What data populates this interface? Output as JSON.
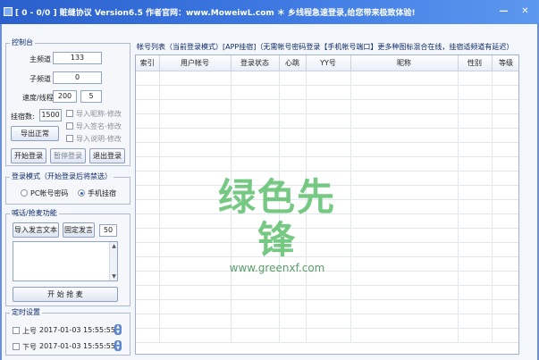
{
  "window": {
    "title": "[ 0 - 0/0 ]   赃缝协议 Version6.5   作者官网：www.MoweiwL.com   ＊  乡线程急速登录,给您带来极致体验!",
    "minimize": "—",
    "close": "✕"
  },
  "control": {
    "legend": "控制台",
    "main_channel_label": "主频道",
    "main_channel_value": "133",
    "sub_channel_label": "子频道",
    "sub_channel_value": "0",
    "speed_label": "速度/线程",
    "speed_value": "200",
    "thread_value": "5",
    "hosting_label": "挂宿数:",
    "hosting_value": "1500",
    "export_button": "导出正常",
    "import_nickname": "导入昵称-修改",
    "import_signature": "导入签名-修改",
    "import_description": "导入说明-修改",
    "start_login": "开始登录",
    "pause_login": "暂停登录",
    "exit_login": "退出登录"
  },
  "login_mode": {
    "legend": "登录模式（开始登录后将禁选）",
    "pc_option": "PC帐号密码",
    "mobile_option": "手机挂宿",
    "selected": "mobile"
  },
  "shout": {
    "legend": "喊话/抢麦功能",
    "import_text": "导入发言文本",
    "fixed_text": "固定发言",
    "interval_value": "50",
    "start_grab": "开 始 抢 麦"
  },
  "timer": {
    "legend": "定时设置",
    "online_label": "上号",
    "online_datetime": "2017-01-03 15:55:55",
    "offline_label": "下号",
    "offline_datetime": "2017-01-03 15:55:55"
  },
  "account_list": {
    "title": "帐号列表（当前登录模式）[APP挂宿]（无需帐号密码登录【手机帐号端口】更多种图标混合在线，挂宿适频道有延迟）",
    "columns": [
      "索引",
      "用户帐号",
      "登录状态",
      "心跳",
      "YY号",
      "昵称",
      "性别",
      "等级"
    ]
  },
  "watermark": {
    "cn": "绿色先锋",
    "url": "www.greenxf.com"
  },
  "colors": {
    "titlebar": "#3f7be3",
    "accent": "#2a64c8",
    "watermark": "#5fc06e"
  }
}
